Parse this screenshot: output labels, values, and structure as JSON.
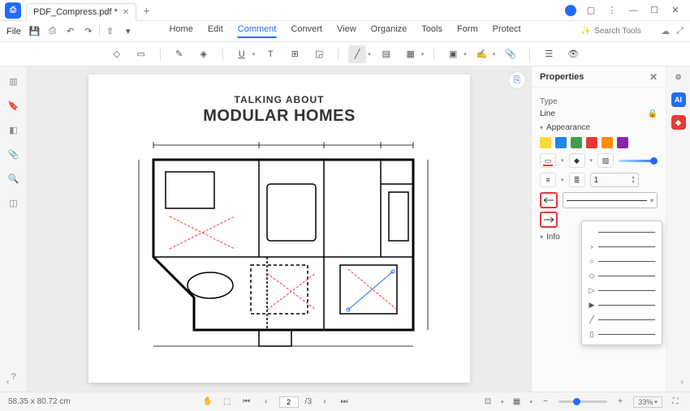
{
  "titlebar": {
    "tab_name": "PDF_Compress.pdf *"
  },
  "menubar": {
    "file_label": "File",
    "items": [
      "Home",
      "Edit",
      "Comment",
      "Convert",
      "View",
      "Organize",
      "Tools",
      "Form",
      "Protect"
    ],
    "active_index": 2,
    "search_placeholder": "Search Tools"
  },
  "document": {
    "subtitle": "TALKING ABOUT",
    "title": "MODULAR HOMES"
  },
  "properties": {
    "header": "Properties",
    "type_label": "Type",
    "type_value": "Line",
    "appearance_label": "Appearance",
    "colors": [
      "yellow",
      "blue",
      "green",
      "red",
      "orange",
      "purple"
    ],
    "selected_color_index": 3,
    "thickness_value": "1",
    "info_label": "Info",
    "line_end_options_count": 8
  },
  "statusbar": {
    "dimensions": "58.35 x 80.72 cm",
    "page_current": "2",
    "page_total": "/3",
    "zoom_value": "33%"
  }
}
